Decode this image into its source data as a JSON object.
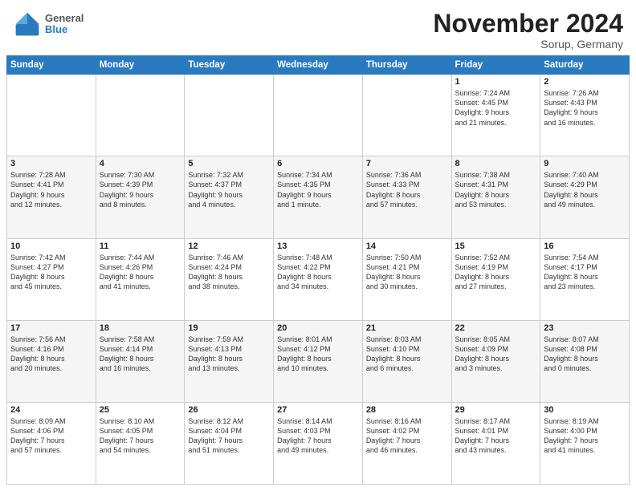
{
  "header": {
    "logo_general": "General",
    "logo_blue": "Blue",
    "month": "November 2024",
    "location": "Sorup, Germany"
  },
  "weekdays": [
    "Sunday",
    "Monday",
    "Tuesday",
    "Wednesday",
    "Thursday",
    "Friday",
    "Saturday"
  ],
  "weeks": [
    [
      {
        "day": "",
        "info": ""
      },
      {
        "day": "",
        "info": ""
      },
      {
        "day": "",
        "info": ""
      },
      {
        "day": "",
        "info": ""
      },
      {
        "day": "",
        "info": ""
      },
      {
        "day": "1",
        "info": "Sunrise: 7:24 AM\nSunset: 4:45 PM\nDaylight: 9 hours\nand 21 minutes."
      },
      {
        "day": "2",
        "info": "Sunrise: 7:26 AM\nSunset: 4:43 PM\nDaylight: 9 hours\nand 16 minutes."
      }
    ],
    [
      {
        "day": "3",
        "info": "Sunrise: 7:28 AM\nSunset: 4:41 PM\nDaylight: 9 hours\nand 12 minutes."
      },
      {
        "day": "4",
        "info": "Sunrise: 7:30 AM\nSunset: 4:39 PM\nDaylight: 9 hours\nand 8 minutes."
      },
      {
        "day": "5",
        "info": "Sunrise: 7:32 AM\nSunset: 4:37 PM\nDaylight: 9 hours\nand 4 minutes."
      },
      {
        "day": "6",
        "info": "Sunrise: 7:34 AM\nSunset: 4:35 PM\nDaylight: 9 hours\nand 1 minute."
      },
      {
        "day": "7",
        "info": "Sunrise: 7:36 AM\nSunset: 4:33 PM\nDaylight: 8 hours\nand 57 minutes."
      },
      {
        "day": "8",
        "info": "Sunrise: 7:38 AM\nSunset: 4:31 PM\nDaylight: 8 hours\nand 53 minutes."
      },
      {
        "day": "9",
        "info": "Sunrise: 7:40 AM\nSunset: 4:29 PM\nDaylight: 8 hours\nand 49 minutes."
      }
    ],
    [
      {
        "day": "10",
        "info": "Sunrise: 7:42 AM\nSunset: 4:27 PM\nDaylight: 8 hours\nand 45 minutes."
      },
      {
        "day": "11",
        "info": "Sunrise: 7:44 AM\nSunset: 4:26 PM\nDaylight: 8 hours\nand 41 minutes."
      },
      {
        "day": "12",
        "info": "Sunrise: 7:46 AM\nSunset: 4:24 PM\nDaylight: 8 hours\nand 38 minutes."
      },
      {
        "day": "13",
        "info": "Sunrise: 7:48 AM\nSunset: 4:22 PM\nDaylight: 8 hours\nand 34 minutes."
      },
      {
        "day": "14",
        "info": "Sunrise: 7:50 AM\nSunset: 4:21 PM\nDaylight: 8 hours\nand 30 minutes."
      },
      {
        "day": "15",
        "info": "Sunrise: 7:52 AM\nSunset: 4:19 PM\nDaylight: 8 hours\nand 27 minutes."
      },
      {
        "day": "16",
        "info": "Sunrise: 7:54 AM\nSunset: 4:17 PM\nDaylight: 8 hours\nand 23 minutes."
      }
    ],
    [
      {
        "day": "17",
        "info": "Sunrise: 7:56 AM\nSunset: 4:16 PM\nDaylight: 8 hours\nand 20 minutes."
      },
      {
        "day": "18",
        "info": "Sunrise: 7:58 AM\nSunset: 4:14 PM\nDaylight: 8 hours\nand 16 minutes."
      },
      {
        "day": "19",
        "info": "Sunrise: 7:59 AM\nSunset: 4:13 PM\nDaylight: 8 hours\nand 13 minutes."
      },
      {
        "day": "20",
        "info": "Sunrise: 8:01 AM\nSunset: 4:12 PM\nDaylight: 8 hours\nand 10 minutes."
      },
      {
        "day": "21",
        "info": "Sunrise: 8:03 AM\nSunset: 4:10 PM\nDaylight: 8 hours\nand 6 minutes."
      },
      {
        "day": "22",
        "info": "Sunrise: 8:05 AM\nSunset: 4:09 PM\nDaylight: 8 hours\nand 3 minutes."
      },
      {
        "day": "23",
        "info": "Sunrise: 8:07 AM\nSunset: 4:08 PM\nDaylight: 8 hours\nand 0 minutes."
      }
    ],
    [
      {
        "day": "24",
        "info": "Sunrise: 8:09 AM\nSunset: 4:06 PM\nDaylight: 7 hours\nand 57 minutes."
      },
      {
        "day": "25",
        "info": "Sunrise: 8:10 AM\nSunset: 4:05 PM\nDaylight: 7 hours\nand 54 minutes."
      },
      {
        "day": "26",
        "info": "Sunrise: 8:12 AM\nSunset: 4:04 PM\nDaylight: 7 hours\nand 51 minutes."
      },
      {
        "day": "27",
        "info": "Sunrise: 8:14 AM\nSunset: 4:03 PM\nDaylight: 7 hours\nand 49 minutes."
      },
      {
        "day": "28",
        "info": "Sunrise: 8:16 AM\nSunset: 4:02 PM\nDaylight: 7 hours\nand 46 minutes."
      },
      {
        "day": "29",
        "info": "Sunrise: 8:17 AM\nSunset: 4:01 PM\nDaylight: 7 hours\nand 43 minutes."
      },
      {
        "day": "30",
        "info": "Sunrise: 8:19 AM\nSunset: 4:00 PM\nDaylight: 7 hours\nand 41 minutes."
      }
    ]
  ]
}
